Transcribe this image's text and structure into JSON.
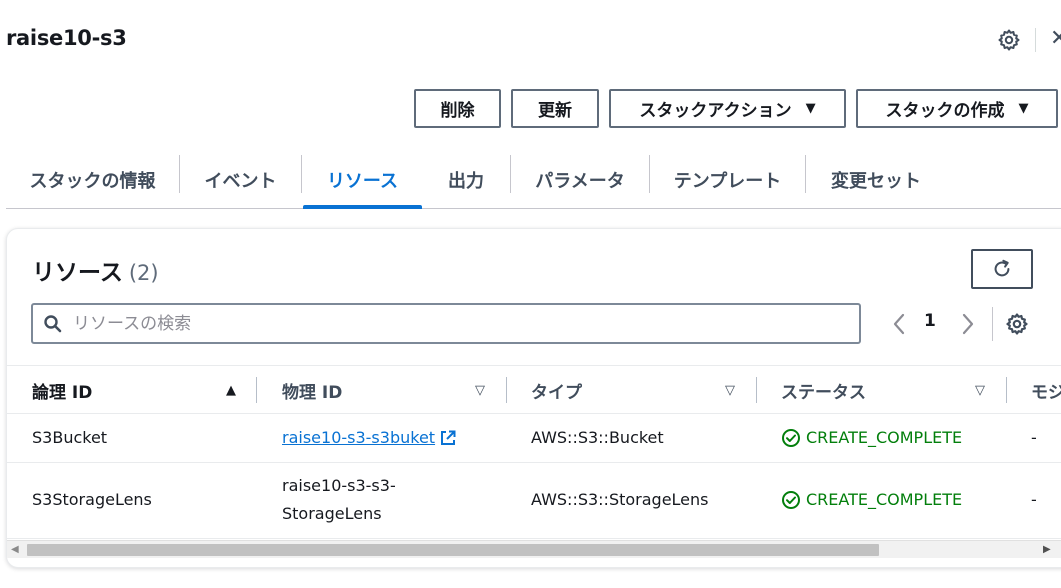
{
  "header": {
    "title": "raise10-s3",
    "close_glyph": "✕",
    "icons": [
      "gear-icon",
      "close-icon"
    ]
  },
  "actions": {
    "delete_label": "削除",
    "update_label": "更新",
    "stack_actions_label": "スタックアクション",
    "create_stack_label": "スタックの作成",
    "caret": "▼"
  },
  "tabs": [
    {
      "label": "スタックの情報"
    },
    {
      "label": "イベント"
    },
    {
      "label": "リソース",
      "active": true
    },
    {
      "label": "出力"
    },
    {
      "label": "パラメータ"
    },
    {
      "label": "テンプレート"
    },
    {
      "label": "変更セット"
    }
  ],
  "resources": {
    "heading": "リソース",
    "count": "(2)",
    "search_placeholder": "リソースの検索",
    "search_value": "",
    "page": "1",
    "columns": [
      {
        "label": "論理 ID",
        "sort": "▲"
      },
      {
        "label": "物理 ID",
        "sort": "▽"
      },
      {
        "label": "タイプ",
        "sort": "▽"
      },
      {
        "label": "ステータス",
        "sort": "▽"
      },
      {
        "label": "モジ"
      }
    ],
    "rows": [
      {
        "logical_id": "S3Bucket",
        "physical_id": "raise10-s3-s3buket",
        "physical_is_link": true,
        "type": "AWS::S3::Bucket",
        "status": "CREATE_COMPLETE",
        "module": "-"
      },
      {
        "logical_id": "S3StorageLens",
        "physical_id_line1": "raise10-s3-s3-",
        "physical_id_line2": "StorageLens",
        "type": "AWS::S3::StorageLens",
        "status": "CREATE_COMPLETE",
        "module": "-"
      }
    ]
  },
  "scrollbar": {
    "left_arrow": "◀",
    "right_arrow": "▶"
  },
  "colors": {
    "link": "#0972d3",
    "success": "#037f0c",
    "text": "#16191f",
    "border": "#5f6b7a"
  }
}
